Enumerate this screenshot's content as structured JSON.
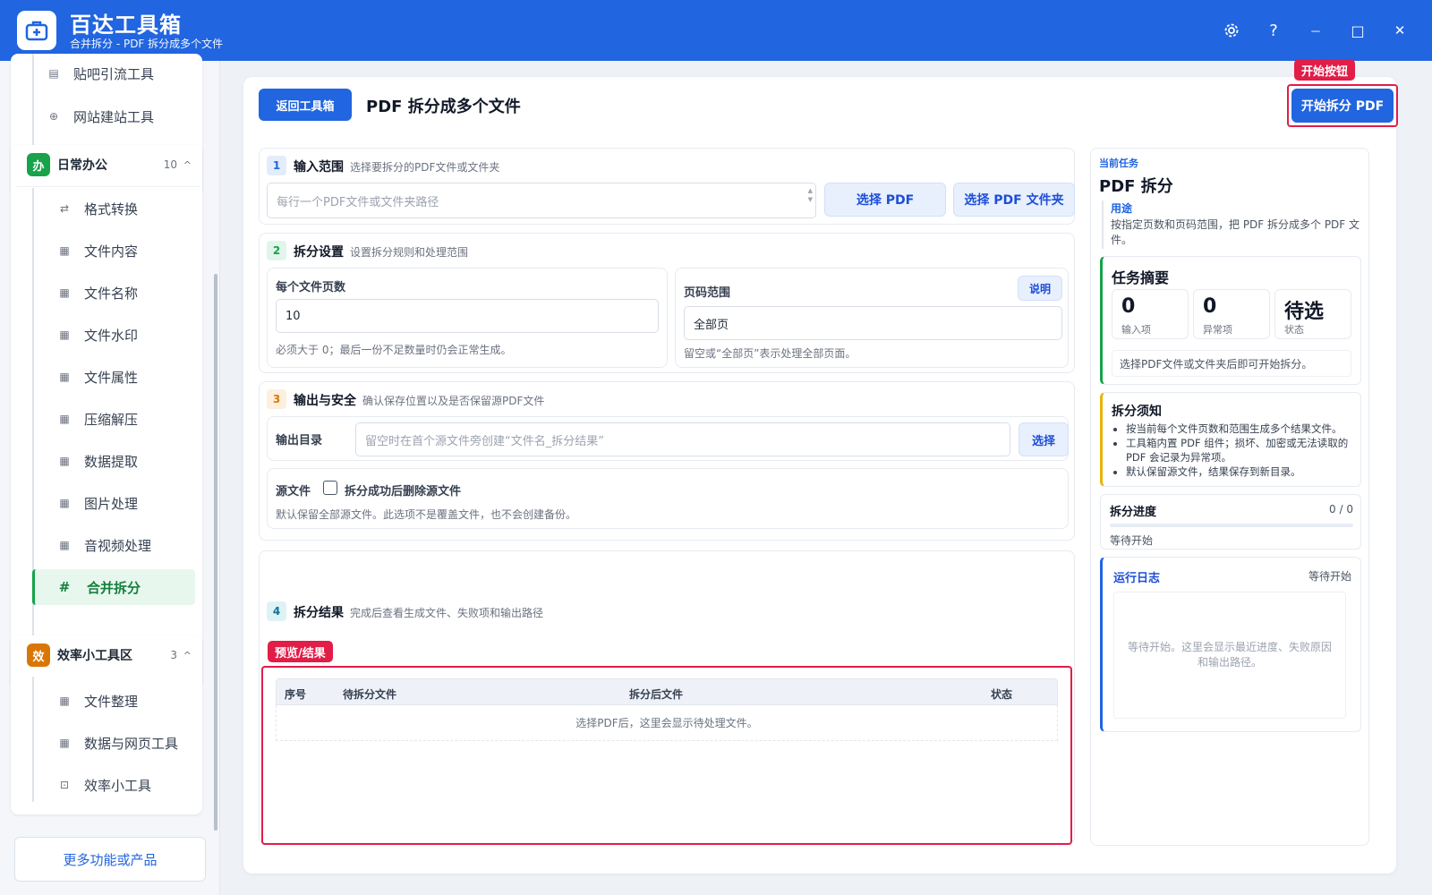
{
  "app": {
    "title": "百达工具箱",
    "subtitle": "合并拆分 - PDF 拆分成多个文件"
  },
  "window": {
    "settings_icon": "gear-icon",
    "help": "?",
    "minimize": "－",
    "maximize": "□",
    "close": "✕"
  },
  "sidebar": {
    "top_items": [
      {
        "label": "贴吧引流工具",
        "icon": "doc-icon"
      },
      {
        "label": "网站建站工具",
        "icon": "globe-icon"
      }
    ],
    "group_office": {
      "badge": "办",
      "title": "日常办公",
      "count": "10",
      "chevron": "^",
      "items": [
        {
          "label": "格式转换",
          "icon": "swap-icon"
        },
        {
          "label": "文件内容",
          "icon": "grid-icon"
        },
        {
          "label": "文件名称",
          "icon": "grid-icon"
        },
        {
          "label": "文件水印",
          "icon": "grid-icon"
        },
        {
          "label": "文件属性",
          "icon": "grid-icon"
        },
        {
          "label": "压缩解压",
          "icon": "grid-icon"
        },
        {
          "label": "数据提取",
          "icon": "grid-icon"
        },
        {
          "label": "图片处理",
          "icon": "grid-icon"
        },
        {
          "label": "音视频处理",
          "icon": "grid-icon"
        },
        {
          "label": "合并拆分",
          "icon": "hash-icon",
          "active": true
        }
      ]
    },
    "group_efficiency": {
      "badge": "效",
      "title": "效率小工具区",
      "count": "3",
      "chevron": "^",
      "items": [
        {
          "label": "文件整理",
          "icon": "grid-icon"
        },
        {
          "label": "数据与网页工具",
          "icon": "grid-icon"
        },
        {
          "label": "效率小工具",
          "icon": "box-icon"
        }
      ]
    },
    "more_button": "更多功能或产品"
  },
  "header": {
    "back_button": "返回工具箱",
    "page_title": "PDF 拆分成多个文件",
    "start_tag": "开始按钮",
    "start_button": "开始拆分 PDF"
  },
  "section1": {
    "num": "1",
    "title": "输入范围",
    "desc": "选择要拆分的PDF文件或文件夹",
    "textarea_placeholder": "每行一个PDF文件或文件夹路径",
    "pick_pdf": "选择 PDF",
    "pick_folder": "选择 PDF 文件夹"
  },
  "section2": {
    "num": "2",
    "title": "拆分设置",
    "desc": "设置拆分规则和处理范围",
    "pages_per_file": {
      "label": "每个文件页数",
      "value": "10",
      "hint": "必须大于 0；最后一份不足数量时仍会正常生成。"
    },
    "page_range": {
      "label": "页码范围",
      "help_button": "说明",
      "value": "全部页",
      "hint": "留空或“全部页”表示处理全部页面。"
    }
  },
  "section3": {
    "num": "3",
    "title": "输出与安全",
    "desc": "确认保存位置以及是否保留源PDF文件",
    "output_label": "输出目录",
    "output_placeholder": "留空时在首个源文件旁创建“文件名_拆分结果”",
    "output_button": "选择",
    "source_label": "源文件",
    "delete_checkbox": "拆分成功后删除源文件",
    "delete_checked": false,
    "source_hint": "默认保留全部源文件。此选项不是覆盖文件，也不会创建备份。"
  },
  "section4": {
    "num": "4",
    "title": "拆分结果",
    "desc": "完成后查看生成文件、失败项和输出路径",
    "tag": "预览/结果",
    "columns": [
      "序号",
      "待拆分文件",
      "拆分后文件",
      "状态"
    ],
    "empty": "选择PDF后，这里会显示待处理文件。"
  },
  "right": {
    "task": {
      "label": "当前任务",
      "name": "PDF 拆分",
      "usage_label": "用途",
      "usage_text": "按指定页数和页码范围，把 PDF 拆分成多个 PDF 文件。"
    },
    "summary": {
      "title": "任务摘要",
      "inputs_value": "0",
      "inputs_label": "输入项",
      "errors_value": "0",
      "errors_label": "异常项",
      "status_value": "待选",
      "status_label": "状态",
      "hint": "选择PDF文件或文件夹后即可开始拆分。"
    },
    "notice": {
      "title": "拆分须知",
      "items": [
        "按当前每个文件页数和范围生成多个结果文件。",
        "工具箱内置 PDF 组件；损坏、加密或无法读取的 PDF 会记录为异常项。",
        "默认保留源文件，结果保存到新目录。"
      ]
    },
    "progress": {
      "title": "拆分进度",
      "count": "0 / 0",
      "fraction": 0,
      "status": "等待开始"
    },
    "log": {
      "title": "运行日志",
      "status": "等待开始",
      "placeholder": "等待开始。这里会显示最近进度、失败原因和输出路径。"
    }
  },
  "colors": {
    "primary": "#2165e0",
    "active_green": "#16a34a",
    "annotation_red": "#e11d48",
    "office_badge": "#16a34a",
    "efficiency_badge": "#d97706"
  }
}
